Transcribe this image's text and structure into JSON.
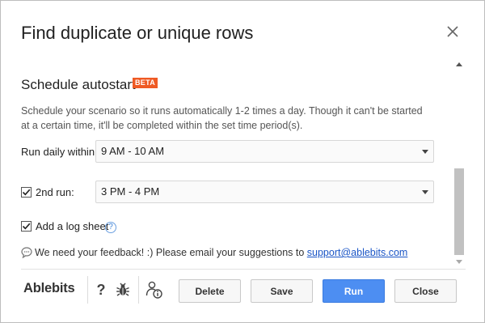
{
  "dialog": {
    "title": "Find duplicate or unique rows"
  },
  "schedule": {
    "section_title": "Schedule autostart",
    "badge": "BETA",
    "description": "Schedule your scenario so it runs automatically 1-2 times a day. Though it can't be started at a certain time, it'll be completed within the set time period(s).",
    "run_daily_label": "Run daily within:",
    "run_daily_value": "9 AM - 10 AM",
    "second_run_label": "2nd run:",
    "second_run_checked": true,
    "second_run_value": "3 PM - 4 PM",
    "log_sheet_label": "Add a log sheet",
    "log_sheet_checked": true,
    "help_glyph": "?",
    "feedback_text": "We need your feedback! :) Please email your suggestions to",
    "feedback_link": "support@ablebits.com"
  },
  "footer": {
    "logo": "Ablebits",
    "help_glyph": "?",
    "buttons": {
      "delete": "Delete",
      "save": "Save",
      "run": "Run",
      "close": "Close"
    }
  },
  "colors": {
    "accent_blue": "#4d8ef2",
    "beta_orange": "#ef5a24",
    "link_blue": "#1a55c6"
  },
  "icons": {
    "close": "close-icon",
    "help": "question-circle-icon",
    "feedback": "speech-bubble-icon",
    "footer_help": "question-mark-icon",
    "bug": "bug-icon",
    "info": "user-info-icon",
    "dropdown": "caret-down-icon",
    "check": "checkmark-icon"
  }
}
